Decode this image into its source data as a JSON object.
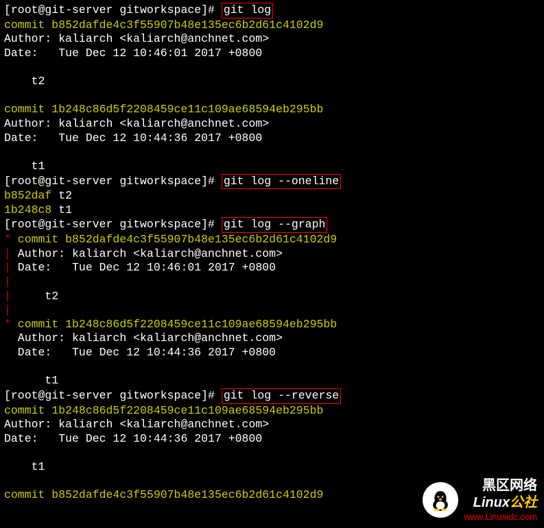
{
  "prompt": "[root@git-server gitworkspace]# ",
  "commands": {
    "git_log": "git log",
    "git_log_oneline": "git log --oneline",
    "git_log_graph": "git log --graph",
    "git_log_reverse": "git log --reverse"
  },
  "commits": {
    "full_hash_1": "commit b852dafde4c3f55907b48e135ec6b2d61c4102d9",
    "full_hash_2": "commit 1b248c86d5f2208459ce11c109ae68594eb295bb",
    "author": "Author: kaliarch <kaliarch@anchnet.com>",
    "date_1": "Date:   Tue Dec 12 10:46:01 2017 +0800",
    "date_2": "Date:   Tue Dec 12 10:44:36 2017 +0800",
    "msg_1": "    t2",
    "msg_2": "    t1"
  },
  "oneline": {
    "short_1": "b852daf",
    "short_2": "1b248c8",
    "msg_1": " t2",
    "msg_2": " t1"
  },
  "graph": {
    "star": "*",
    "pipe": "|",
    "full_hash_1": " commit b852dafde4c3f55907b48e135ec6b2d61c4102d9",
    "full_hash_2": " commit 1b248c86d5f2208459ce11c109ae68594eb295bb",
    "author": " Author: kaliarch <kaliarch@anchnet.com>",
    "date_1": " Date:   Tue Dec 12 10:46:01 2017 +0800",
    "date_2": " Date:   Tue Dec 12 10:44:36 2017 +0800",
    "msg_1": "     t2",
    "msg_2": "     t1",
    "sp": " ",
    "indent_author": "  Author: kaliarch <kaliarch@anchnet.com>",
    "indent_date_2": "  Date:   Tue Dec 12 10:44:36 2017 +0800",
    "indent_msg_2": "      t1"
  },
  "watermark": {
    "cn": "黑区网络",
    "brand_prefix": "Linux",
    "brand_suffix": "公社",
    "url": "www.Linuxidc.com"
  }
}
